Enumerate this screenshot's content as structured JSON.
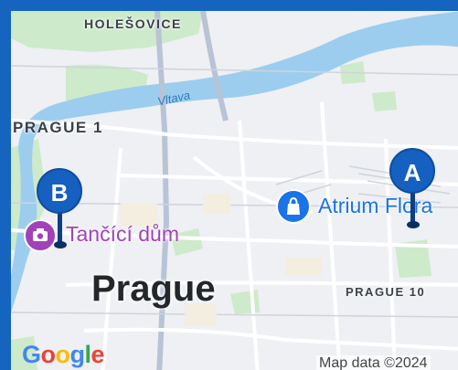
{
  "map": {
    "districts": {
      "holesovice": "HOLEŠOVICE",
      "prague1": "PRAGUE 1",
      "prague10": "PRAGUE 10"
    },
    "city": "Prague",
    "river": "Vltava",
    "pois": {
      "dancing_house": "Tančící dům",
      "atrium": "Atrium Flora"
    },
    "markers": {
      "a": "A",
      "b": "B"
    },
    "logo_letters": [
      "G",
      "o",
      "o",
      "g",
      "l",
      "e"
    ],
    "attribution": "Map data ©2024"
  },
  "colors": {
    "frame": "#1565c0",
    "marker": "#1560c0",
    "water": "#9ccdef",
    "park": "#cdeacb",
    "poi_pink": "#a142b8",
    "poi_blue": "#1a73e8"
  },
  "icons": {
    "dancing_house": "camera-icon",
    "atrium": "shopping-bag-icon"
  }
}
